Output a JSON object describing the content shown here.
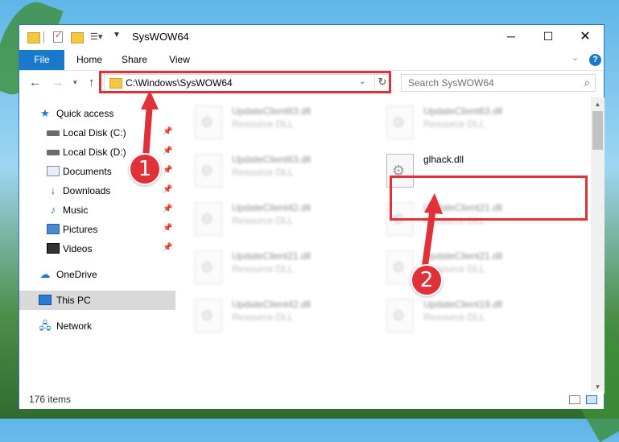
{
  "window": {
    "title": "SysWOW64",
    "controls": {
      "minimize": "─",
      "maximize": "☐",
      "close": "✕"
    }
  },
  "ribbon": {
    "tabs": [
      "File",
      "Home",
      "Share",
      "View"
    ]
  },
  "navigation": {
    "address": "C:\\Windows\\SysWOW64",
    "search_placeholder": "Search SysWOW64"
  },
  "sidebar": {
    "items": [
      {
        "label": "Quick access",
        "icon": "star-icon",
        "pinned": false
      },
      {
        "label": "Local Disk (C:)",
        "icon": "disk-icon",
        "pinned": true
      },
      {
        "label": "Local Disk (D:)",
        "icon": "disk-icon",
        "pinned": true
      },
      {
        "label": "Documents",
        "icon": "documents-icon",
        "pinned": true
      },
      {
        "label": "Downloads",
        "icon": "download-icon",
        "pinned": true
      },
      {
        "label": "Music",
        "icon": "music-icon",
        "pinned": true
      },
      {
        "label": "Pictures",
        "icon": "pictures-icon",
        "pinned": true
      },
      {
        "label": "Videos",
        "icon": "videos-icon",
        "pinned": true
      },
      {
        "label": "OneDrive",
        "icon": "cloud-icon",
        "pinned": false
      },
      {
        "label": "This PC",
        "icon": "pc-icon",
        "pinned": false,
        "selected": true
      },
      {
        "label": "Network",
        "icon": "network-icon",
        "pinned": false
      }
    ]
  },
  "files": [
    {
      "name": "UpdateClient63.dll",
      "type": "Resource DLL",
      "blurred": true
    },
    {
      "name": "UpdateClient63.dll",
      "type": "Resource DLL",
      "blurred": true
    },
    {
      "name": "UpdateClient63.dll",
      "type": "Resource DLL",
      "blurred": true
    },
    {
      "name": "glhack.dll",
      "type": "",
      "blurred": false,
      "highlighted": true
    },
    {
      "name": "UpdateClient42.dll",
      "type": "Resource DLL",
      "blurred": true
    },
    {
      "name": "UpdateClient21.dll",
      "type": "Resource DLL",
      "blurred": true
    },
    {
      "name": "UpdateClient21.dll",
      "type": "Resource DLL",
      "blurred": true
    },
    {
      "name": "UpdateClient21.dll",
      "type": "Resource DLL",
      "blurred": true
    },
    {
      "name": "UpdateClient42.dll",
      "type": "Resource DLL",
      "blurred": true
    },
    {
      "name": "UpdateClient19.dll",
      "type": "Resource DLL",
      "blurred": true
    }
  ],
  "status": {
    "item_count": "176 items"
  },
  "annotations": {
    "step1": "1",
    "step2": "2",
    "color": "#e0303a"
  },
  "colors": {
    "accent": "#1979ca",
    "border": "#2b74c6"
  }
}
